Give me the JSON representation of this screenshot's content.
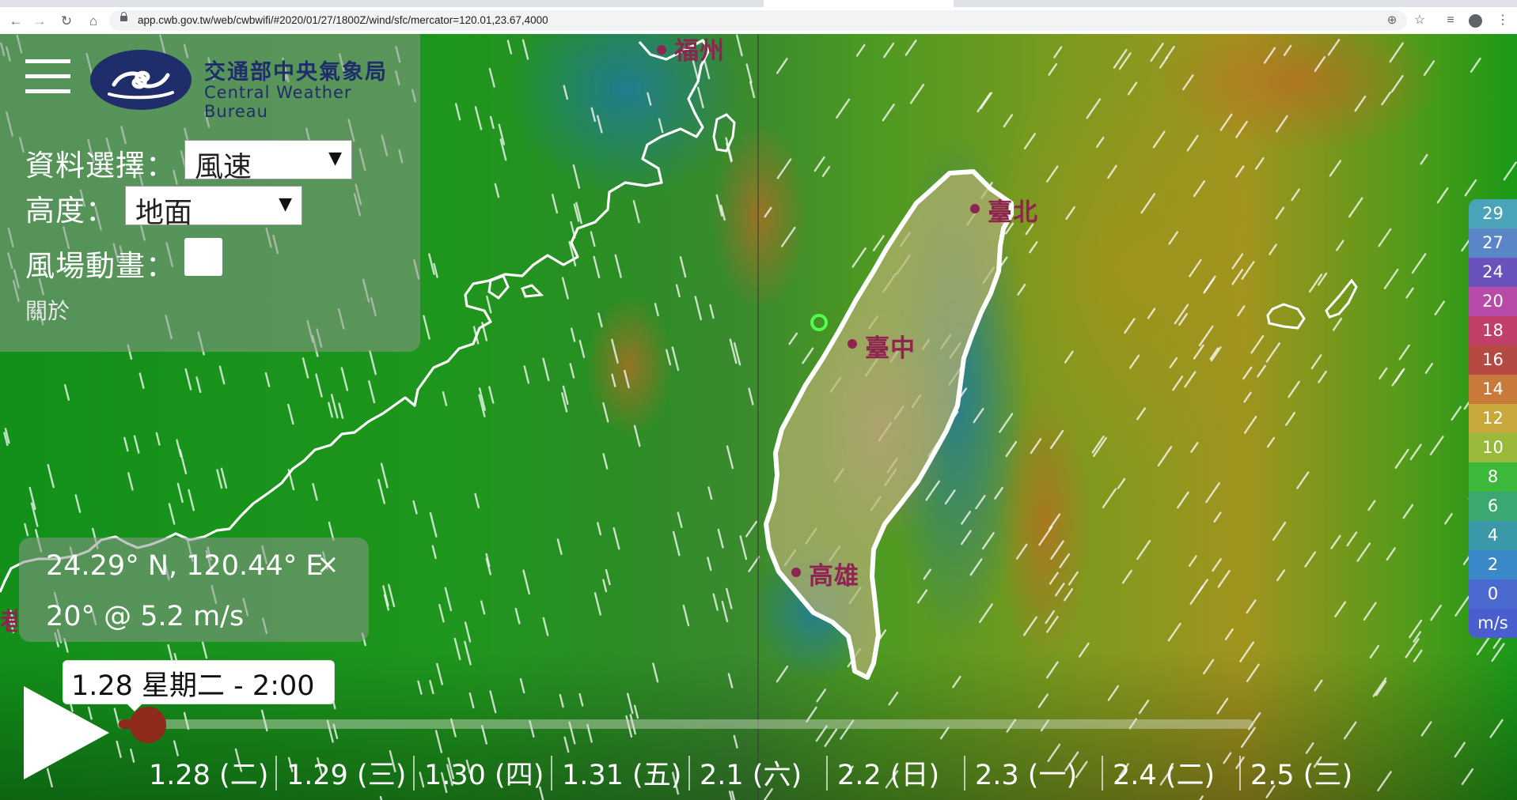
{
  "browser": {
    "url": "app.cwb.gov.tw/web/cwbwifi/#2020/01/27/1800Z/wind/sfc/mercator=120.01,23.67,4000",
    "back_icon": "arrow-left",
    "forward_icon": "arrow-right",
    "reload_icon": "reload",
    "home_icon": "home",
    "zoom_icon": "magnifier",
    "star_icon": "star",
    "media_icon": "media-queue",
    "profile_icon": "account-circle",
    "menu_icon": "kebab"
  },
  "panel": {
    "logo_cn": "交通部中央氣象局",
    "logo_en": "Central Weather Bureau",
    "data_label": "資料選擇：",
    "data_value": "風速",
    "height_label": "高度：",
    "height_value": "地面",
    "anim_label": "風場動畫：",
    "about": "關於"
  },
  "cities": {
    "taipei": "臺北",
    "taichung": "臺中",
    "kaohsiung": "高雄",
    "fuzhou": "福州",
    "partial_left": "巷"
  },
  "info": {
    "coord": "24.29° N, 120.44° E",
    "close": "×",
    "wind": "20° @ 5.2 m/s"
  },
  "player": {
    "current_time": "1.28 星期二 - 2:00",
    "progress": 0.02,
    "dates": [
      "1.28 (二)",
      "1.29 (三)",
      "1.30 (四)",
      "1.31 (五)",
      "2.1 (六)",
      "2.2 (日)",
      "2.3 (一)",
      "2.4 (二)",
      "2.5 (三)"
    ]
  },
  "legend": {
    "values": [
      "29",
      "27",
      "24",
      "20",
      "18",
      "16",
      "14",
      "12",
      "10",
      "8",
      "6",
      "4",
      "2",
      "0"
    ],
    "colors": [
      "#4aa3b8",
      "#5a86c8",
      "#6a52bc",
      "#b84aa8",
      "#c0406a",
      "#b44a42",
      "#c87a3a",
      "#c8a83a",
      "#9ab83a",
      "#3cb83a",
      "#3aa870",
      "#3a98a8",
      "#3a88c8",
      "#4a6ad0"
    ],
    "unit": "m/s"
  }
}
